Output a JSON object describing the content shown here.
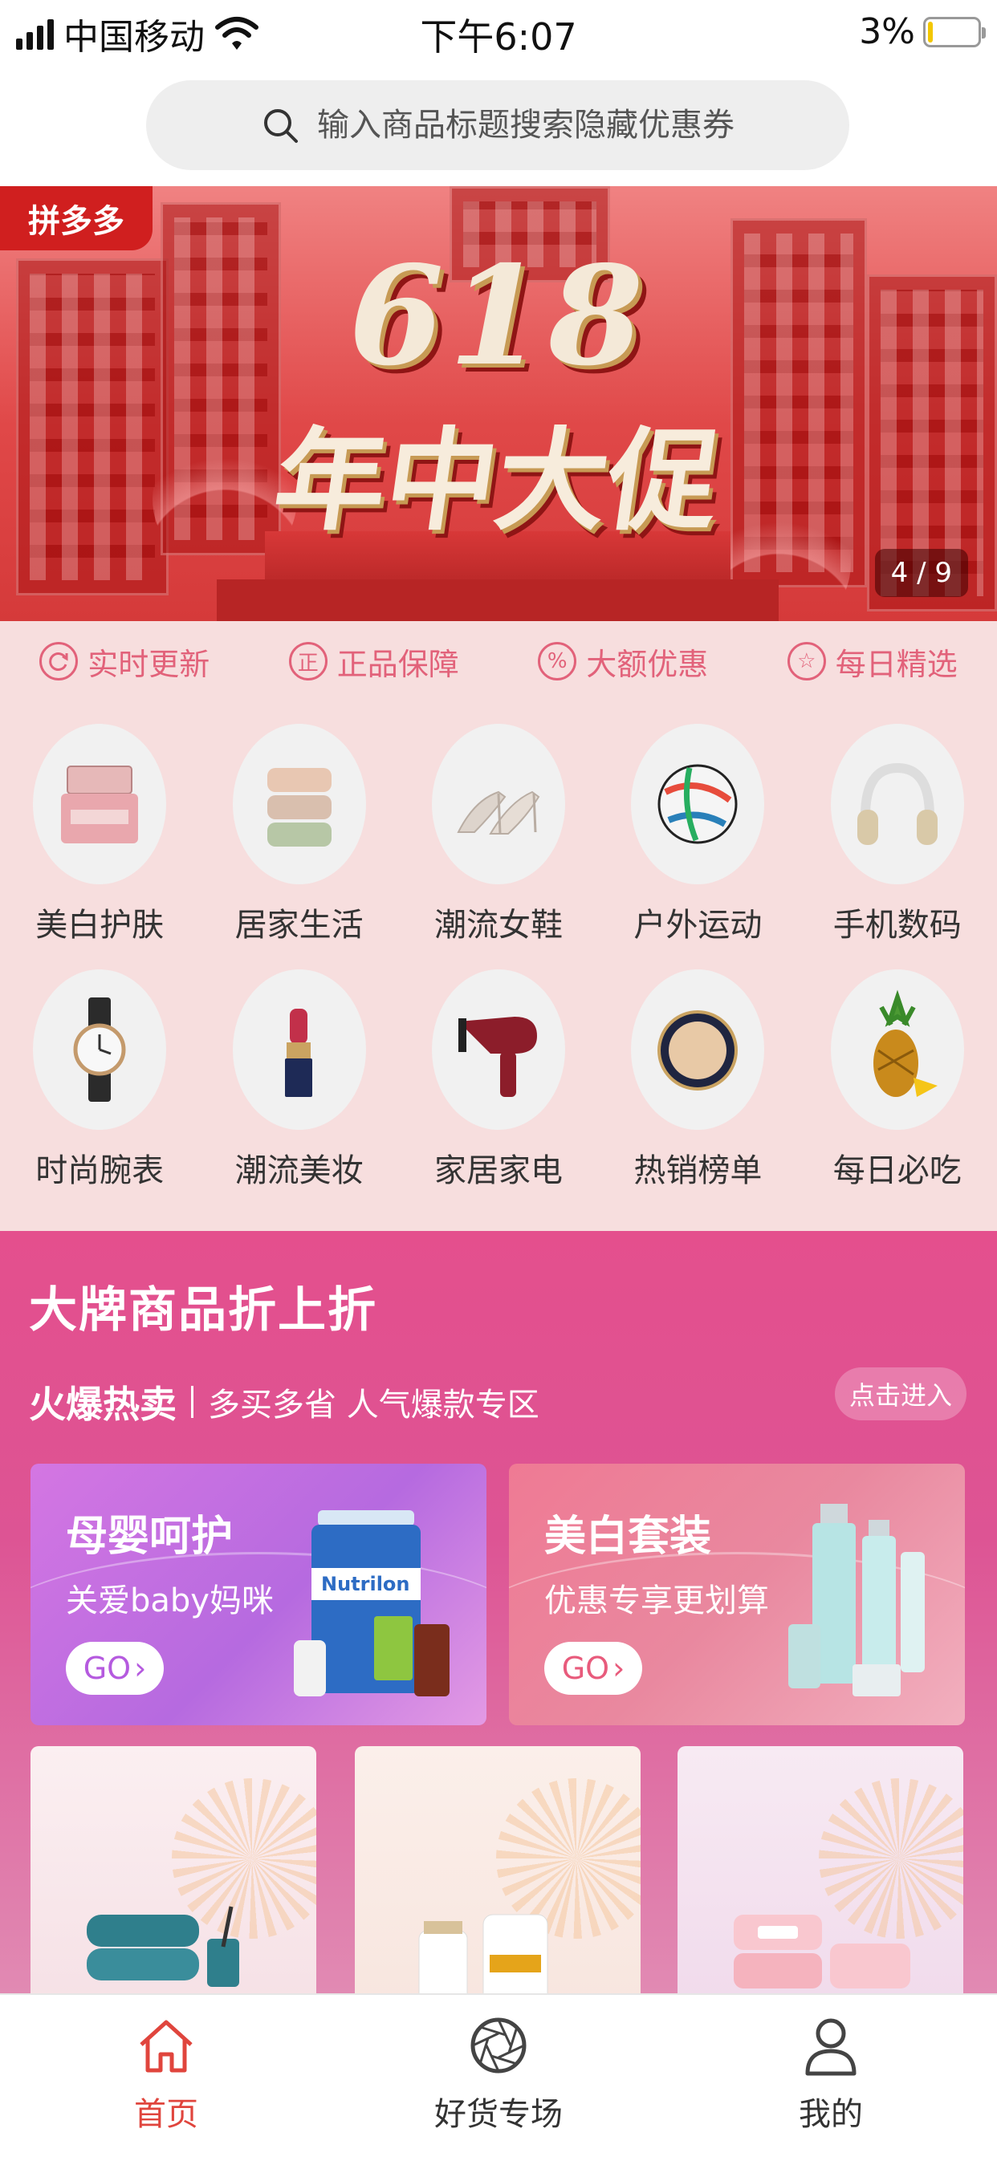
{
  "status_bar": {
    "carrier": "中国移动",
    "time": "下午6:07",
    "battery": "3%"
  },
  "search": {
    "placeholder": "输入商品标题搜索隐藏优惠券"
  },
  "banner": {
    "brand_badge": "拼多多",
    "headline_number": "618",
    "headline_text": "年中大促",
    "pager": "4 / 9",
    "colors": {
      "primary": "#e04848",
      "text": "#f4e9d8"
    }
  },
  "guarantees": [
    {
      "icon": "refresh-icon",
      "label": "实时更新"
    },
    {
      "icon": "genuine-icon",
      "label": "正品保障"
    },
    {
      "icon": "discount-icon",
      "label": "大额优惠"
    },
    {
      "icon": "star-icon",
      "label": "每日精选"
    }
  ],
  "categories": [
    {
      "icon": "skincare-jar-icon",
      "label": "美白护肤"
    },
    {
      "icon": "towels-icon",
      "label": "居家生活"
    },
    {
      "icon": "heels-icon",
      "label": "潮流女鞋"
    },
    {
      "icon": "football-icon",
      "label": "户外运动"
    },
    {
      "icon": "headphones-icon",
      "label": "手机数码"
    },
    {
      "icon": "wristwatch-icon",
      "label": "时尚腕表"
    },
    {
      "icon": "lipstick-icon",
      "label": "潮流美妆"
    },
    {
      "icon": "hairdryer-icon",
      "label": "家居家电"
    },
    {
      "icon": "cushion-compact-icon",
      "label": "热销榜单"
    },
    {
      "icon": "pineapple-icon",
      "label": "每日必吃"
    }
  ],
  "promo": {
    "title": "大牌商品折上折",
    "hot_label": "火爆热卖",
    "description": "多买多省 人气爆款专区",
    "enter_label": "点击进入",
    "cards": [
      {
        "title": "母婴呵护",
        "subtitle": "关爱baby妈咪",
        "go_label": "GO",
        "product_text": "Nutrilon"
      },
      {
        "title": "美白套装",
        "subtitle": "优惠专享更划算",
        "go_label": "GO"
      }
    ]
  },
  "tabbar": {
    "items": [
      {
        "icon": "home-icon",
        "label": "首页",
        "active": true
      },
      {
        "icon": "aperture-icon",
        "label": "好货专场",
        "active": false
      },
      {
        "icon": "user-icon",
        "label": "我的",
        "active": false
      }
    ],
    "active_color": "#e0453d"
  }
}
